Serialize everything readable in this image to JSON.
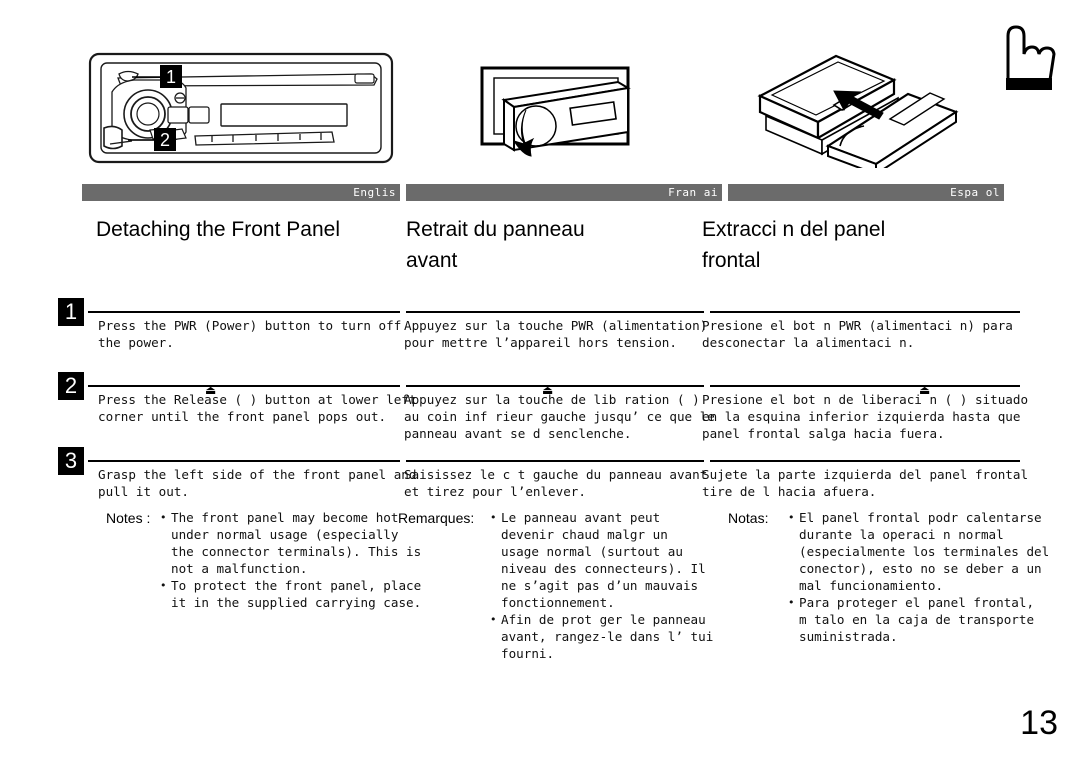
{
  "page": {
    "number": "13"
  },
  "illustrations": {
    "unit": {
      "name": "car-stereo-front-panel-diagram",
      "callout_1": "1",
      "callout_2": "2"
    },
    "tilt": {
      "name": "panel-tilting-forward-diagram"
    },
    "case": {
      "name": "carrying-case-diagram"
    },
    "hand": {
      "name": "pointing-hand-icon"
    }
  },
  "languages": {
    "english": {
      "bar_label": "Englis",
      "heading": "Detaching the Front Panel",
      "notes_label": "Notes :"
    },
    "french": {
      "bar_label": "Fran ai",
      "heading": "Retrait du panneau\navant",
      "notes_label": "Remarques:"
    },
    "spanish": {
      "bar_label": "Espa ol",
      "heading": "Extracci n del panel\nfrontal",
      "notes_label": "Notas:"
    }
  },
  "steps": [
    {
      "number": "1",
      "english": "Press the PWR (Power) button to turn off\nthe power.",
      "french": "Appuyez sur la touche PWR (alimentation)\npour mettre l’appareil hors tension.",
      "spanish": "Presione el bot n PWR (alimentaci n) para\ndesconectar la alimentaci n."
    },
    {
      "number": "2",
      "english": "Press the Release ( ) button at lower left\ncorner until the front panel pops out.",
      "french": "Appuyez sur la touche de lib ration ( )\nau coin inf rieur gauche jusqu’ ce que le\npanneau avant se d senclenche.",
      "spanish": "Presione el bot n de liberaci n ( ) situado\nen la esquina inferior izquierda hasta que\npanel frontal salga hacia fuera."
    },
    {
      "number": "3",
      "english": "Grasp the left side of the front panel and\npull it out.",
      "french": "Saisissez le c t gauche du panneau avant\net tirez pour l’enlever.",
      "spanish": "Sujete la parte izquierda del panel frontal\ntire de  l hacia afuera."
    }
  ],
  "notes": {
    "english": [
      "The front panel may become hot\nunder normal usage (especially\nthe connector terminals). This is\nnot a malfunction.",
      "To protect the front panel, place\nit in the supplied carrying case."
    ],
    "french": [
      "Le panneau avant peut\ndevenir chaud malgr  un\nusage normal (surtout au\nniveau des connecteurs). Il\nne s’agit pas d’un mauvais\nfonctionnement.",
      "Afin de prot ger le panneau\navant, rangez-le dans l’ tui\nfourni."
    ],
    "spanish": [
      "El panel frontal podr  calentarse\ndurante la operaci n normal\n(especialmente los terminales del\nconector), esto no se deber  a un\nmal funcionamiento.",
      "Para proteger el panel frontal,\nm talo en la caja de transporte\nsuministrada."
    ]
  },
  "glyphs": {
    "eject": "⏏"
  },
  "colors": {
    "bar_background": "#6b6b6b",
    "bar_text": "#ffffff",
    "badge_background": "#000000",
    "badge_text": "#ffffff",
    "page_background": "#ffffff",
    "body_text": "#111111"
  }
}
